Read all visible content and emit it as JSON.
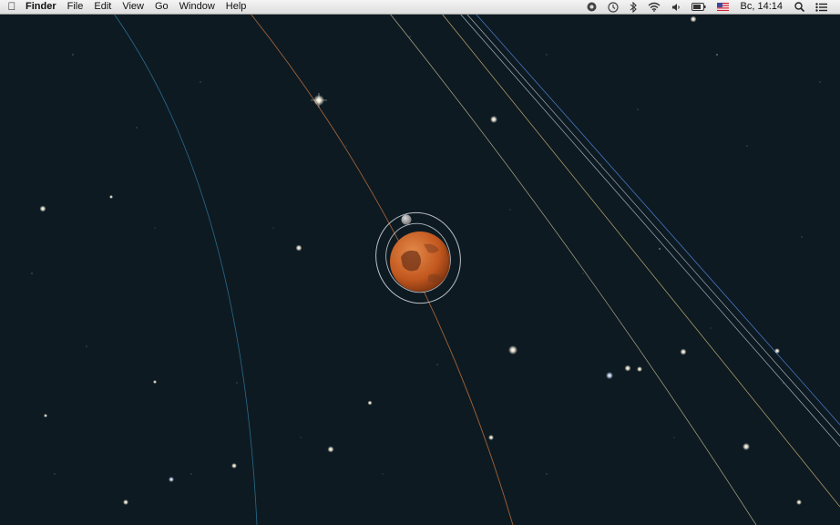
{
  "menubar": {
    "apple_icon": "apple-logo-icon",
    "app_name": "Finder",
    "menus": [
      "File",
      "Edit",
      "View",
      "Go",
      "Window",
      "Help"
    ],
    "status_icons": [
      "record-icon",
      "time-machine-icon",
      "bluetooth-icon",
      "wifi-icon",
      "volume-icon",
      "battery-icon",
      "us-flag-icon"
    ],
    "clock": "Вс, 14:14",
    "search_icon": "spotlight-search-icon",
    "list_icon": "notification-center-icon"
  },
  "scene": {
    "planet": "mars",
    "planet_color": "#c8642a",
    "background_color": "#0e1a22"
  }
}
